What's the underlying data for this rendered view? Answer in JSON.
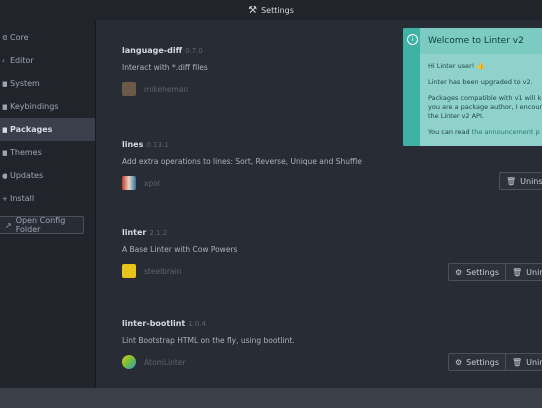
{
  "titlebar": {
    "title": "Settings",
    "icon": "tools-icon"
  },
  "sidebar": {
    "items": [
      {
        "label": "Core",
        "icon": "gear-icon"
      },
      {
        "label": "Editor",
        "icon": "code-icon"
      },
      {
        "label": "System",
        "icon": "device-icon"
      },
      {
        "label": "Keybindings",
        "icon": "keyboard-icon"
      },
      {
        "label": "Packages",
        "icon": "package-icon"
      },
      {
        "label": "Themes",
        "icon": "paintcan-icon"
      },
      {
        "label": "Updates",
        "icon": "cloud-download-icon"
      },
      {
        "label": "Install",
        "icon": "plus-icon"
      }
    ],
    "config_button": "Open Config Folder"
  },
  "packages": [
    {
      "name": "language-diff",
      "version": "0.7.0",
      "description": "Interact with *.diff files",
      "owner": "mikeheman"
    },
    {
      "name": "lines",
      "version": "0.13.1",
      "description": "Add extra operations to lines: Sort, Reverse, Unique and Shuffle",
      "owner": "xpol",
      "uninstall": "Uninsta"
    },
    {
      "name": "linter",
      "version": "2.1.2",
      "description": "A Base Linter with Cow Powers",
      "owner": "steelbrain",
      "settings": "Settings",
      "uninstall": "Uninsta"
    },
    {
      "name": "linter-bootlint",
      "version": "1.0.4",
      "description": "Lint Bootstrap HTML on the fly, using bootlint.",
      "owner": "AtomLinter",
      "settings": "Settings",
      "uninstall": "Uninsta"
    }
  ],
  "notification": {
    "title": "Welcome to Linter v2",
    "greeting": "Hi Linter user!",
    "line1": "Linter has been upgraded to v2.",
    "line2a": "Packages compatible with v1 will k",
    "line2b": "you are a package author, I encour",
    "line2c": "the Linter v2 API.",
    "line3_prefix": "You can read ",
    "line3_link": "the announcement p"
  },
  "colors": {
    "accent": "#3fb2a6",
    "notification_bg": "#8fd1cb",
    "background": "#282c34",
    "sidebar": "#21252b"
  }
}
